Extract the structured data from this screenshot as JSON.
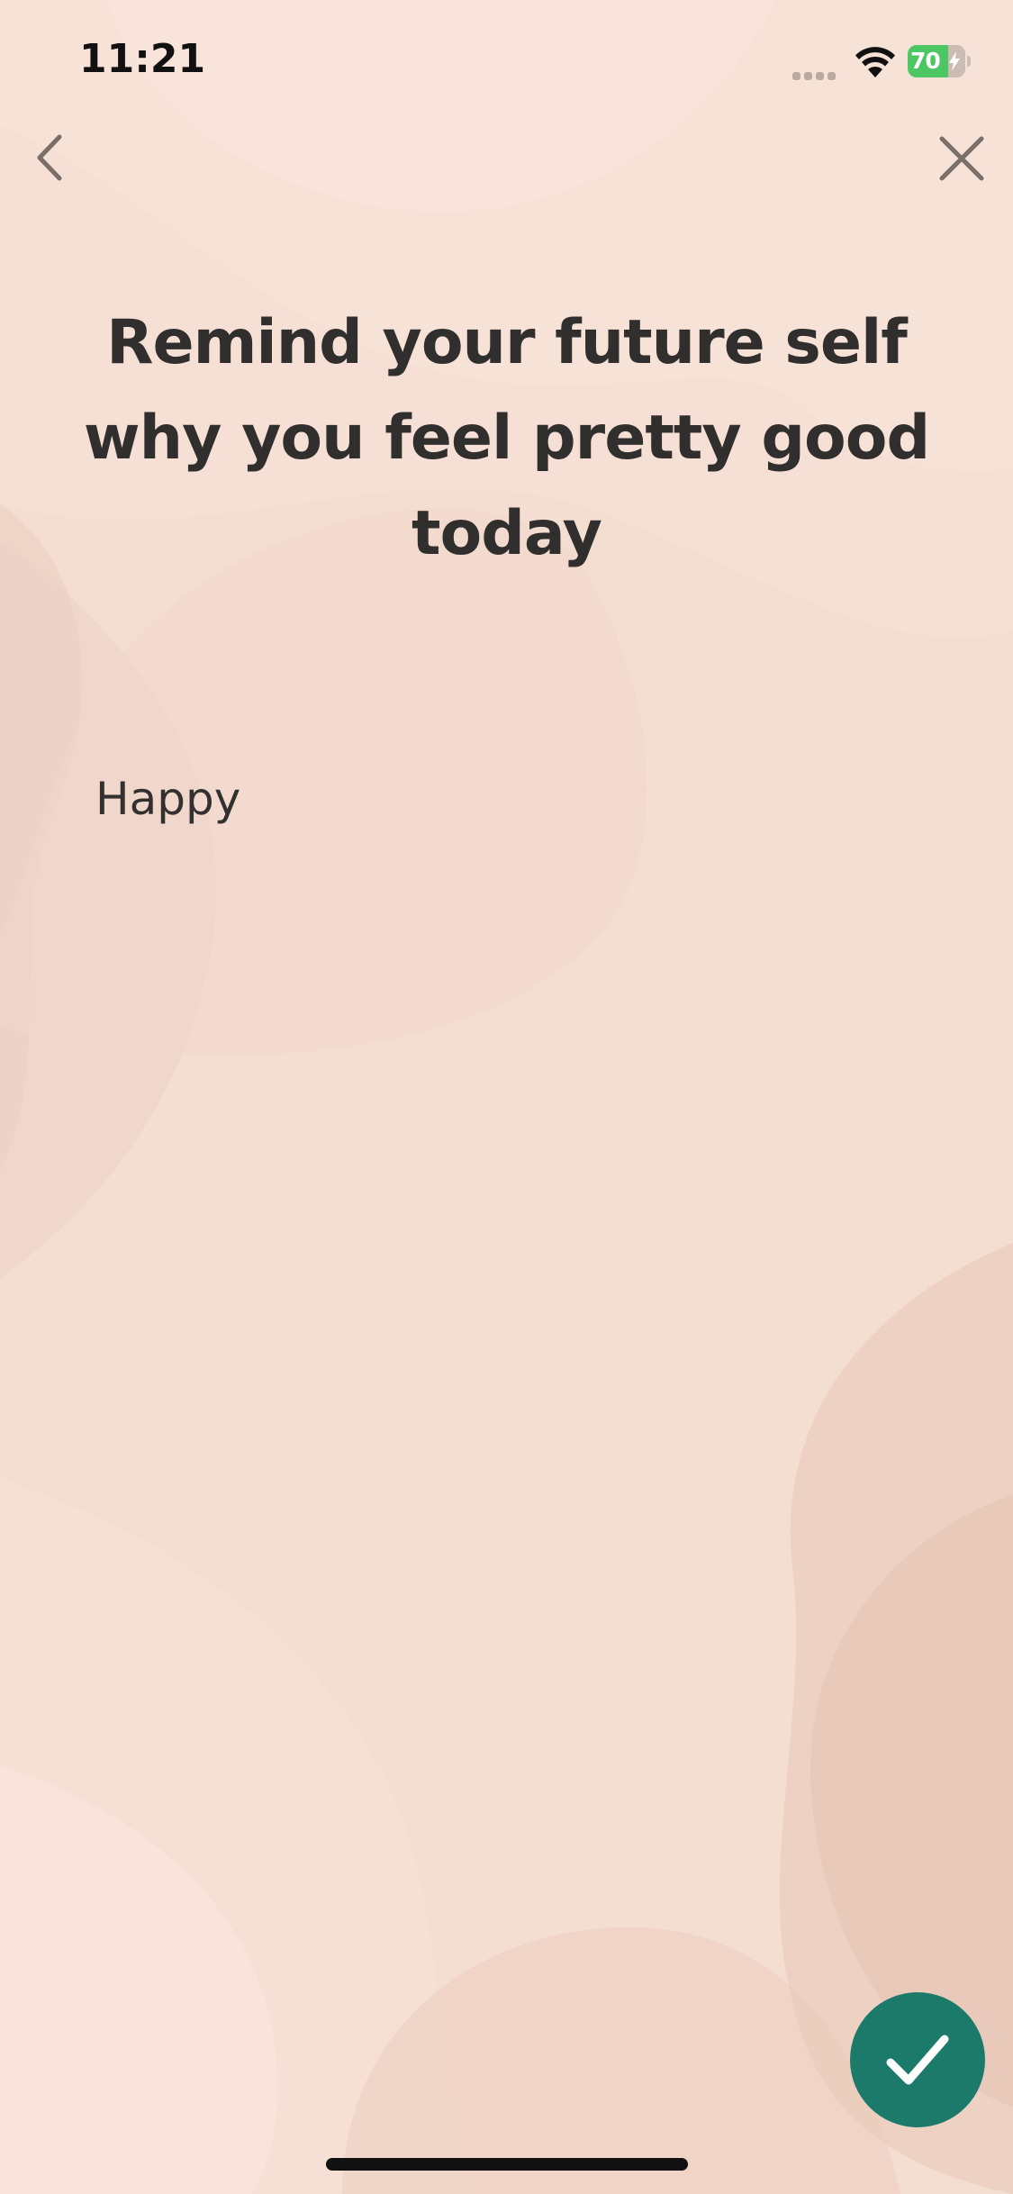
{
  "status_bar": {
    "time": "11:21",
    "battery_percent": "70"
  },
  "prompt": {
    "title": "Remind your future self why you feel pretty good today"
  },
  "entry": {
    "text": "Happy"
  },
  "icons": {
    "back": "chevron-left-icon",
    "close": "close-icon",
    "done": "checkmark-icon"
  },
  "colors": {
    "background": "#f4ddd1",
    "accent": "#1c7a6b",
    "battery": "#4cc764",
    "text": "#312f2e"
  }
}
